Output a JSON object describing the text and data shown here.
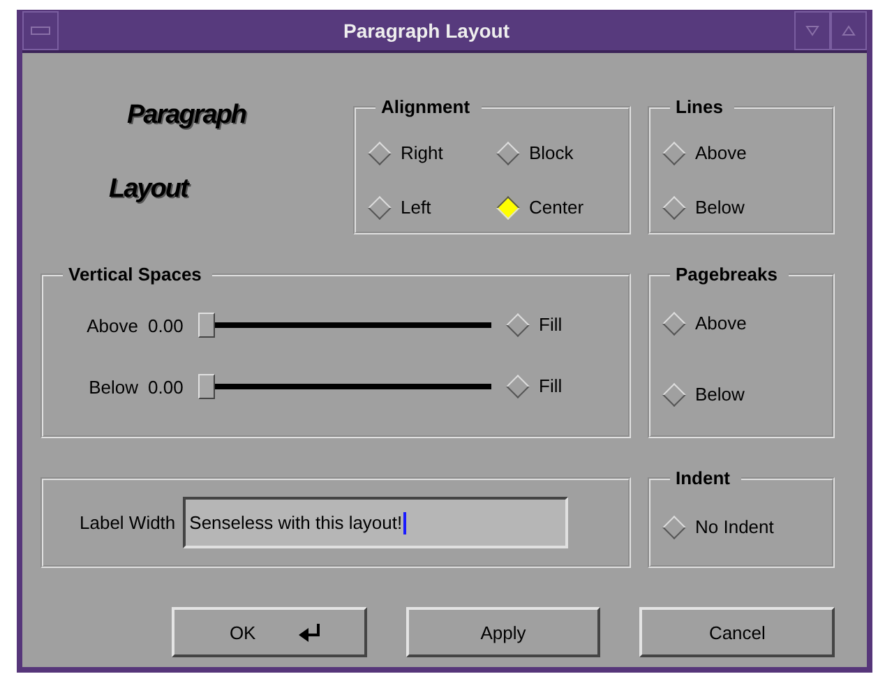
{
  "window": {
    "title": "Paragraph Layout"
  },
  "logo": [
    "Paragraph",
    "Layout"
  ],
  "alignment": {
    "title": "Alignment",
    "options": [
      {
        "label": "Right",
        "selected": false
      },
      {
        "label": "Block",
        "selected": false
      },
      {
        "label": "Left",
        "selected": false
      },
      {
        "label": "Center",
        "selected": true
      }
    ]
  },
  "lines": {
    "title": "Lines",
    "options": [
      {
        "label": "Above",
        "checked": false
      },
      {
        "label": "Below",
        "checked": false
      }
    ]
  },
  "vertical_spaces": {
    "title": "Vertical Spaces",
    "rows": [
      {
        "label": "Above",
        "value": "0.00",
        "level": 0,
        "fill": {
          "label": "Fill",
          "checked": false
        }
      },
      {
        "label": "Below",
        "value": "0.00",
        "level": 0,
        "fill": {
          "label": "Fill",
          "checked": false
        }
      }
    ]
  },
  "pagebreaks": {
    "title": "Pagebreaks",
    "options": [
      {
        "label": "Above",
        "checked": false
      },
      {
        "label": "Below",
        "checked": false
      }
    ]
  },
  "label_width": {
    "label": "Label Width",
    "value": "Senseless with this layout!"
  },
  "indent": {
    "title": "Indent",
    "options": [
      {
        "label": "No Indent",
        "checked": false
      }
    ]
  },
  "buttons": [
    {
      "label": "OK",
      "kind": "default"
    },
    {
      "label": "Apply",
      "kind": "plain"
    },
    {
      "label": "Cancel",
      "kind": "plain"
    }
  ]
}
